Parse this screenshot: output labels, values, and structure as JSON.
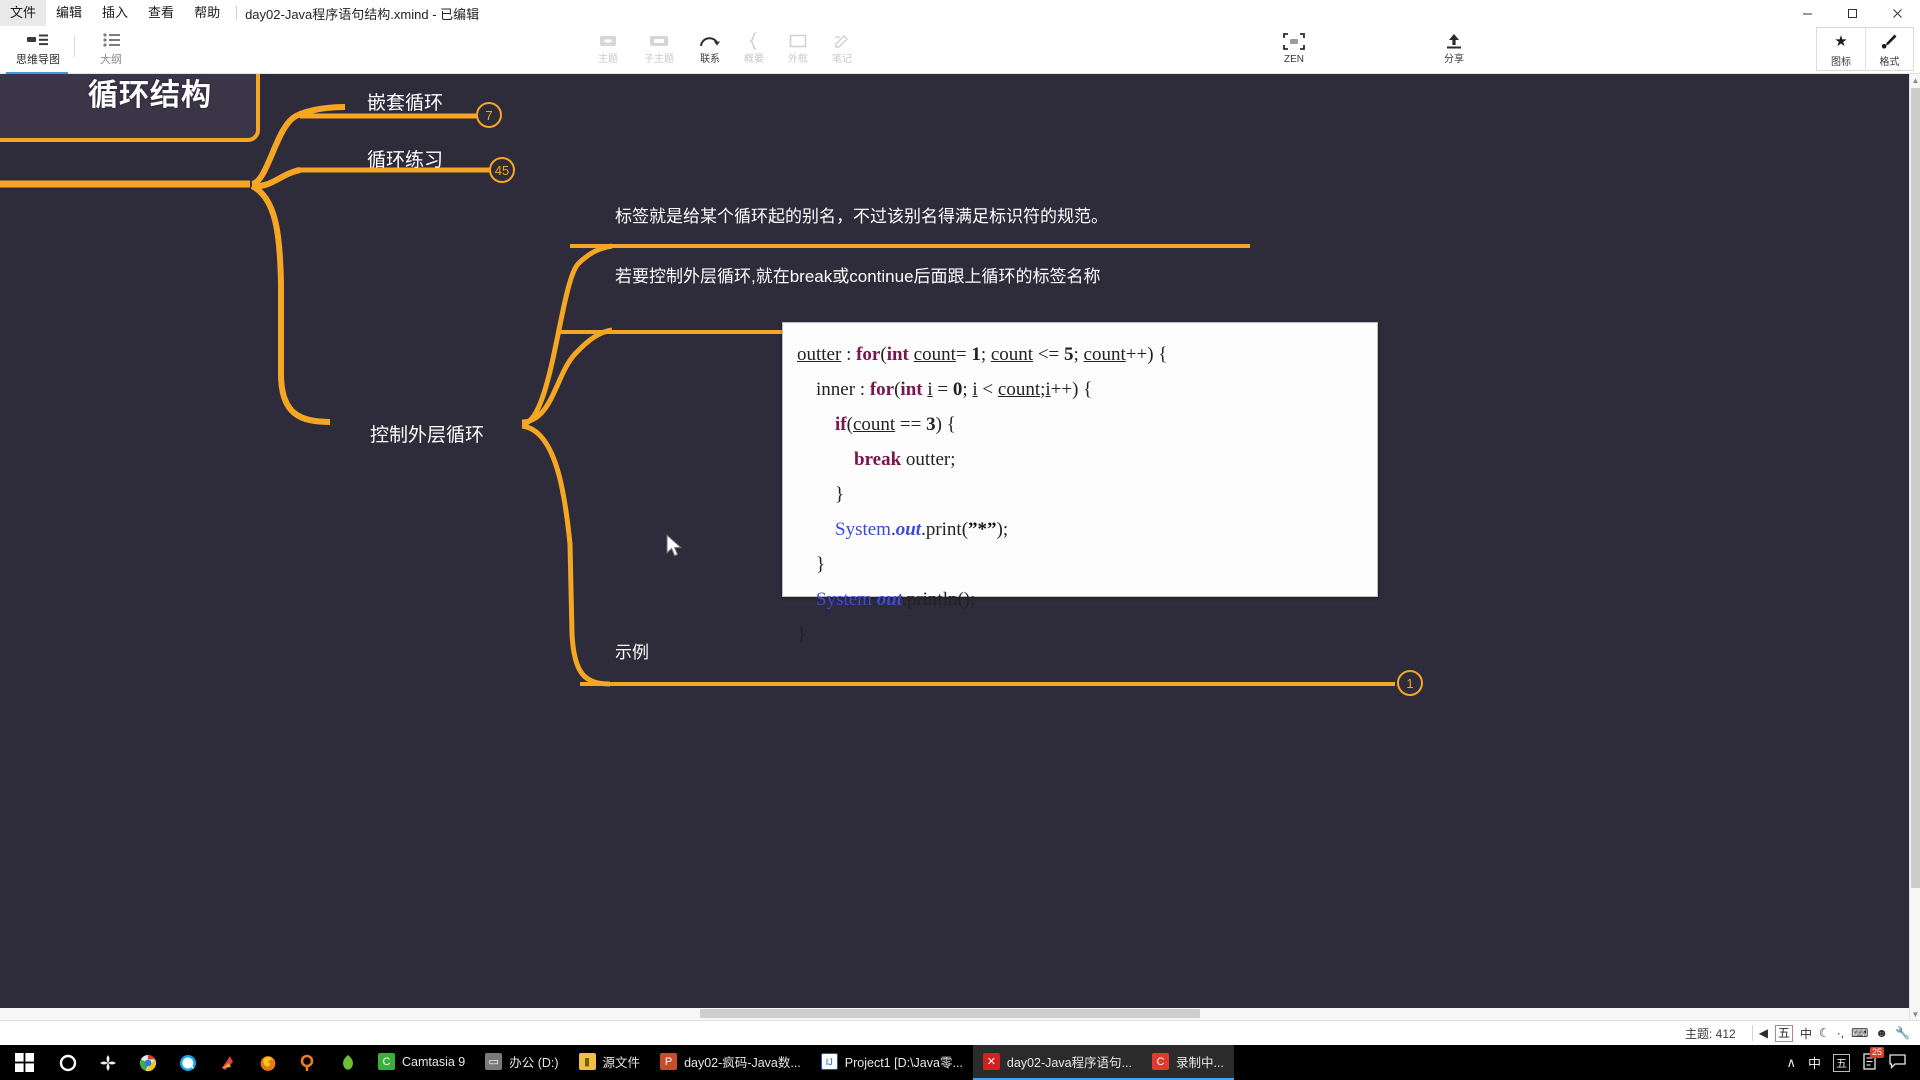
{
  "window": {
    "document_title": "day02-Java程序语句结构.xmind - 已编辑",
    "minimize": "–",
    "maximize": "▢",
    "close": "✕"
  },
  "menubar": {
    "items": [
      {
        "label": "文件"
      },
      {
        "label": "编辑"
      },
      {
        "label": "插入"
      },
      {
        "label": "查看"
      },
      {
        "label": "帮助"
      }
    ]
  },
  "viewmodes": [
    {
      "label": "思维导图",
      "icon": "mindmap-icon",
      "active": true
    },
    {
      "label": "大纲",
      "icon": "outline-icon",
      "active": false
    }
  ],
  "toolbar": {
    "center_buttons": [
      {
        "label": "主题",
        "icon": "topic-icon",
        "dim": true
      },
      {
        "label": "子主题",
        "icon": "subtopic-icon",
        "dim": true
      },
      {
        "label": "联系",
        "icon": "relationship-icon",
        "dim": false
      },
      {
        "label": "概要",
        "icon": "summary-icon",
        "dim": true
      },
      {
        "label": "外框",
        "icon": "boundary-icon",
        "dim": true
      },
      {
        "label": "笔记",
        "icon": "note-icon",
        "dim": true
      }
    ],
    "zen": {
      "label": "ZEN",
      "icon": "zen-icon"
    },
    "share": {
      "label": "分享",
      "icon": "share-icon"
    },
    "right_buttons": [
      {
        "label": "图标",
        "icon": "star-icon"
      },
      {
        "label": "格式",
        "icon": "brush-icon"
      }
    ]
  },
  "canvas": {
    "background_color": "#2e2b3a",
    "branch_color": "#f5a623",
    "root": {
      "label": "循环结构"
    },
    "nodes": [
      {
        "name": "nested-loop",
        "label": "嵌套循环",
        "badge": "7"
      },
      {
        "name": "loop-practice",
        "label": "循环练习",
        "badge": "45"
      },
      {
        "name": "label-explain-1",
        "label": "标签就是给某个循环起的别名，不过该别名得满足标识符的规范。"
      },
      {
        "name": "label-explain-2",
        "label": "若要控制外层循环,就在break或continue后面跟上循环的标签名称"
      },
      {
        "name": "control-outer-loop",
        "label": "控制外层循环"
      },
      {
        "name": "example",
        "label": "示例",
        "badge": "1"
      }
    ],
    "code_block": {
      "lines": [
        "outter : for(int count= 1; count <= 5; count++) {",
        "    inner : for(int i = 0; i < count;i++) {",
        "        if(count == 3) {",
        "            break outter;",
        "        }",
        "        System.out.print(\"*\");",
        "    }",
        "    System.out.println();",
        "}"
      ]
    }
  },
  "statusbar": {
    "topic_count_label": "主题: 412",
    "ime": {
      "lang_box": "五",
      "mode": "中",
      "moon": "☾",
      "punct": "·,",
      "keyboard": "⌨",
      "user": "☻",
      "tools": "🔧"
    }
  },
  "taskbar": {
    "start": "start-icon",
    "quick_launch": [
      {
        "name": "cortana-icon",
        "glyph": "◯",
        "color": "#ffffff"
      },
      {
        "name": "task-view-icon",
        "glyph": "✿",
        "color": "#f2f2f2"
      },
      {
        "name": "chrome-icon",
        "glyph": "◉",
        "color": "#2f9e4f"
      },
      {
        "name": "qq-browser-icon",
        "glyph": "◕",
        "color": "#1aa7e8"
      },
      {
        "name": "app-red-icon",
        "glyph": "◤",
        "color": "#d8453a"
      },
      {
        "name": "firefox-icon",
        "glyph": "◓",
        "color": "#e8761b"
      },
      {
        "name": "search-app-icon",
        "glyph": "ρ",
        "color": "#e87c22"
      },
      {
        "name": "app-green-icon",
        "glyph": "❧",
        "color": "#6fbe2f"
      }
    ],
    "items": [
      {
        "label": "Camtasia 9",
        "icon_glyph": "C",
        "icon_bg": "#3cae3c",
        "active": false
      },
      {
        "label": "办公 (D:)",
        "icon_glyph": "▭",
        "icon_bg": "#6d6d6d",
        "active": false
      },
      {
        "label": "源文件",
        "icon_glyph": "▮",
        "icon_bg": "#f0c040",
        "active": false
      },
      {
        "label": "day02-疯码-Java数...",
        "icon_glyph": "P",
        "icon_bg": "#c94b2c",
        "active": false
      },
      {
        "label": "Project1 [D:\\Java零...",
        "icon_glyph": "IJ",
        "icon_bg": "#2c4ec9",
        "active": false
      },
      {
        "label": "day02-Java程序语句...",
        "icon_glyph": "X",
        "icon_bg": "#cc2222",
        "active": true
      },
      {
        "label": "录制中...",
        "icon_glyph": "C",
        "icon_bg": "#e03a2f",
        "active": true
      }
    ],
    "tray": {
      "chevron": "∧",
      "ime_lang": "中",
      "ime_box": "五",
      "notes_count": "25",
      "action_center": "🗨"
    }
  }
}
